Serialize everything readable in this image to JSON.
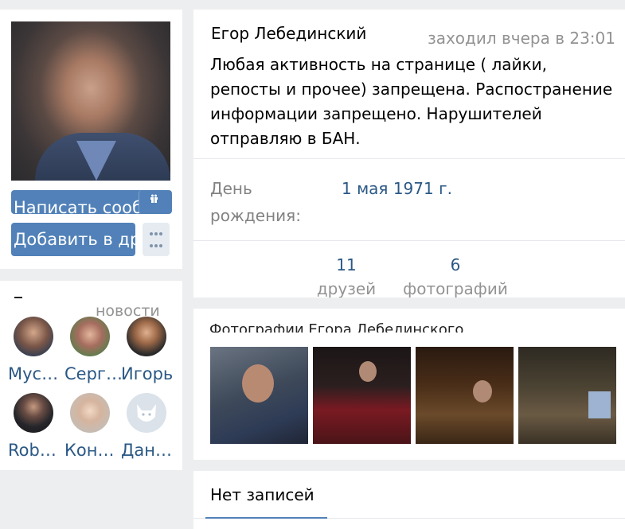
{
  "profile": {
    "name": "Егор Лебединский",
    "online_status": "заходил вчера в 23:01",
    "status_text": "Любая активность на странице ( лайки, репосты и прочее) запрещена. Распостранение информации запрещено. Нарушителей отправляю в БАН.",
    "birthday_label": "День рождения:",
    "birthday_value": "1 мая 1971 г."
  },
  "actions": {
    "message_label": "Написать сообщение",
    "add_friend_label": "Добавить в друзья",
    "gift_icon": "gift-icon",
    "more_icon": "more-dots-icon"
  },
  "counters": [
    {
      "num": "11",
      "label": "друзей"
    },
    {
      "num": "6",
      "label": "фотографий"
    }
  ],
  "friends_block": {
    "title_fragment": "–",
    "news_label": "новости",
    "friends": [
      {
        "name": "Мус…"
      },
      {
        "name": "Серг…"
      },
      {
        "name": "Игорь"
      },
      {
        "name": "Rob…"
      },
      {
        "name": "Кон…"
      },
      {
        "name": "Дан…"
      }
    ]
  },
  "photos_block": {
    "title_partial": "Фотографии Егора Лебединского"
  },
  "wall": {
    "tab_label": "Нет записей"
  },
  "colors": {
    "accent": "#5181b8",
    "link": "#2a5885",
    "muted": "#939393",
    "background": "#edeef0"
  }
}
